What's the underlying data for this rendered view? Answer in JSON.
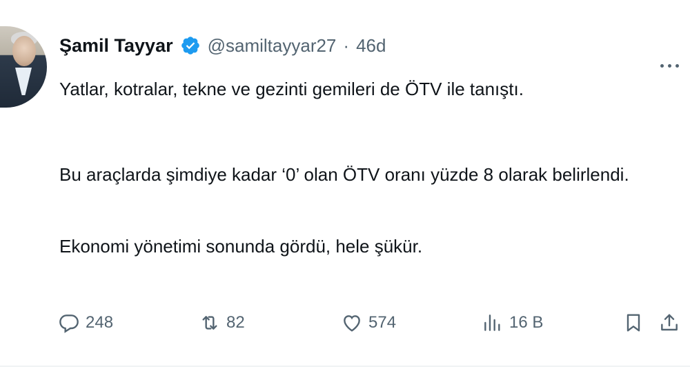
{
  "author": {
    "name": "Şamil Tayyar",
    "handle": "@samiltayyar27",
    "separator": "·",
    "time": "46d"
  },
  "tweet": {
    "paragraphs": [
      "Yatlar, kotralar, tekne ve gezinti gemileri de ÖTV ile tanıştı.",
      "Bu araçlarda şimdiye kadar ‘0’ olan ÖTV oranı yüzde 8 olarak belirlendi.",
      "Ekonomi yönetimi sonunda gördü, hele şükür."
    ]
  },
  "actions": {
    "replies": "248",
    "reposts": "82",
    "likes": "574",
    "views": "16 B"
  },
  "colors": {
    "text": "#0f1419",
    "secondary": "#536471",
    "verified": "#1d9bf0"
  },
  "icons": [
    "avatar",
    "verified-badge-icon",
    "more-icon",
    "reply-icon",
    "repost-icon",
    "like-icon",
    "views-icon",
    "bookmark-icon",
    "share-icon"
  ]
}
